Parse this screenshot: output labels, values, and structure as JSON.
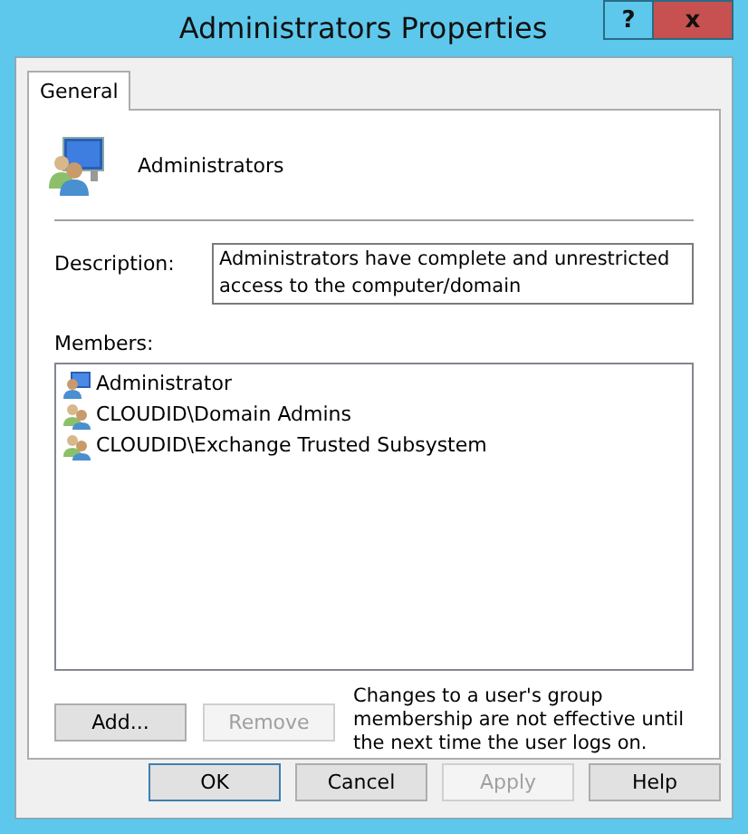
{
  "window": {
    "title": "Administrators Properties",
    "help_button": "?",
    "close_button": "x"
  },
  "tabs": [
    {
      "label": "General",
      "selected": true
    }
  ],
  "group": {
    "name": "Administrators"
  },
  "description": {
    "label": "Description:",
    "value": "Administrators have complete and unrestricted access to the computer/domain"
  },
  "members": {
    "label": "Members:",
    "items": [
      {
        "name": "Administrator",
        "kind": "user",
        "selected": false
      },
      {
        "name": "CLOUDID\\Domain Admins",
        "kind": "group",
        "selected": false
      },
      {
        "name": "CLOUDID\\Exchange Trusted Subsystem",
        "kind": "group",
        "selected": false
      }
    ]
  },
  "member_buttons": [
    {
      "label": "Add...",
      "disabled": false
    },
    {
      "label": "Remove",
      "disabled": true
    }
  ],
  "note": "Changes to a user's group membership are not effective until the next time the user logs on.",
  "buttons": [
    {
      "label": "OK",
      "disabled": false,
      "default": true
    },
    {
      "label": "Cancel",
      "disabled": false,
      "default": false
    },
    {
      "label": "Apply",
      "disabled": true,
      "default": false
    },
    {
      "label": "Help",
      "disabled": false,
      "default": false
    }
  ]
}
